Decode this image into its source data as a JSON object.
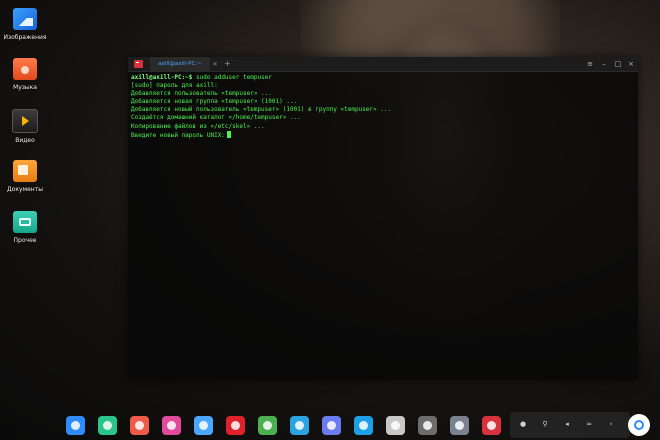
{
  "desktop": {
    "icons": [
      {
        "label": "Изображения",
        "icon": "images-folder-icon"
      },
      {
        "label": "Музыка",
        "icon": "music-folder-icon"
      },
      {
        "label": "Видео",
        "icon": "video-folder-icon"
      },
      {
        "label": "Документы",
        "icon": "documents-folder-icon"
      },
      {
        "label": "Прочее",
        "icon": "other-folder-icon"
      }
    ]
  },
  "terminal": {
    "tab_title": "axill@axill-PC:~",
    "tab_close": "×",
    "tab_add": "+",
    "window_buttons": {
      "menu": "≡",
      "minimize": "–",
      "maximize": "□",
      "close": "×"
    },
    "prompt": "axill@axill-PC:~$",
    "command": " sudo adduser tempuser",
    "output": [
      "[sudo] пароль для axill:",
      "Добавляется пользователь «tempuser» ...",
      "Добавляется новая группа «tempuser» (1001) ...",
      "Добавляется новый пользователь «tempuser» (1001) в группу «tempuser» ...",
      "Создаётся домашний каталог «/home/tempuser» ...",
      "Копирование файлов из «/etc/skel» ...",
      "Введите новый пароль UNIX:"
    ]
  },
  "dock": {
    "apps": [
      {
        "name": "launcher-icon",
        "color": "#2f8cff"
      },
      {
        "name": "file-manager-icon",
        "color": "#2bc48a"
      },
      {
        "name": "screen-recorder-icon",
        "color": "#f05a4a"
      },
      {
        "name": "settings-icon",
        "color": "#e24a9b"
      },
      {
        "name": "app-store-icon",
        "color": "#4aa8ff"
      },
      {
        "name": "opera-icon",
        "color": "#e0202a"
      },
      {
        "name": "chrome-icon",
        "color": "#4caf50"
      },
      {
        "name": "telegram-icon",
        "color": "#2aa3e0"
      },
      {
        "name": "discord-icon",
        "color": "#6b7cf0"
      },
      {
        "name": "skype-icon",
        "color": "#1ea0e8"
      },
      {
        "name": "installer-icon",
        "color": "#c8c8c8"
      },
      {
        "name": "obs-icon",
        "color": "#6d6d6d"
      },
      {
        "name": "steam-icon",
        "color": "#7a8290"
      },
      {
        "name": "terminal-icon",
        "color": "#d8323c"
      }
    ],
    "tray": [
      {
        "name": "network-tray-icon",
        "glyph": "●"
      },
      {
        "name": "usb-tray-icon",
        "glyph": "⚲"
      },
      {
        "name": "volume-tray-icon",
        "glyph": "◂"
      },
      {
        "name": "wifi-tray-icon",
        "glyph": "≈"
      },
      {
        "name": "collapse-tray-icon",
        "glyph": "‹"
      }
    ]
  }
}
